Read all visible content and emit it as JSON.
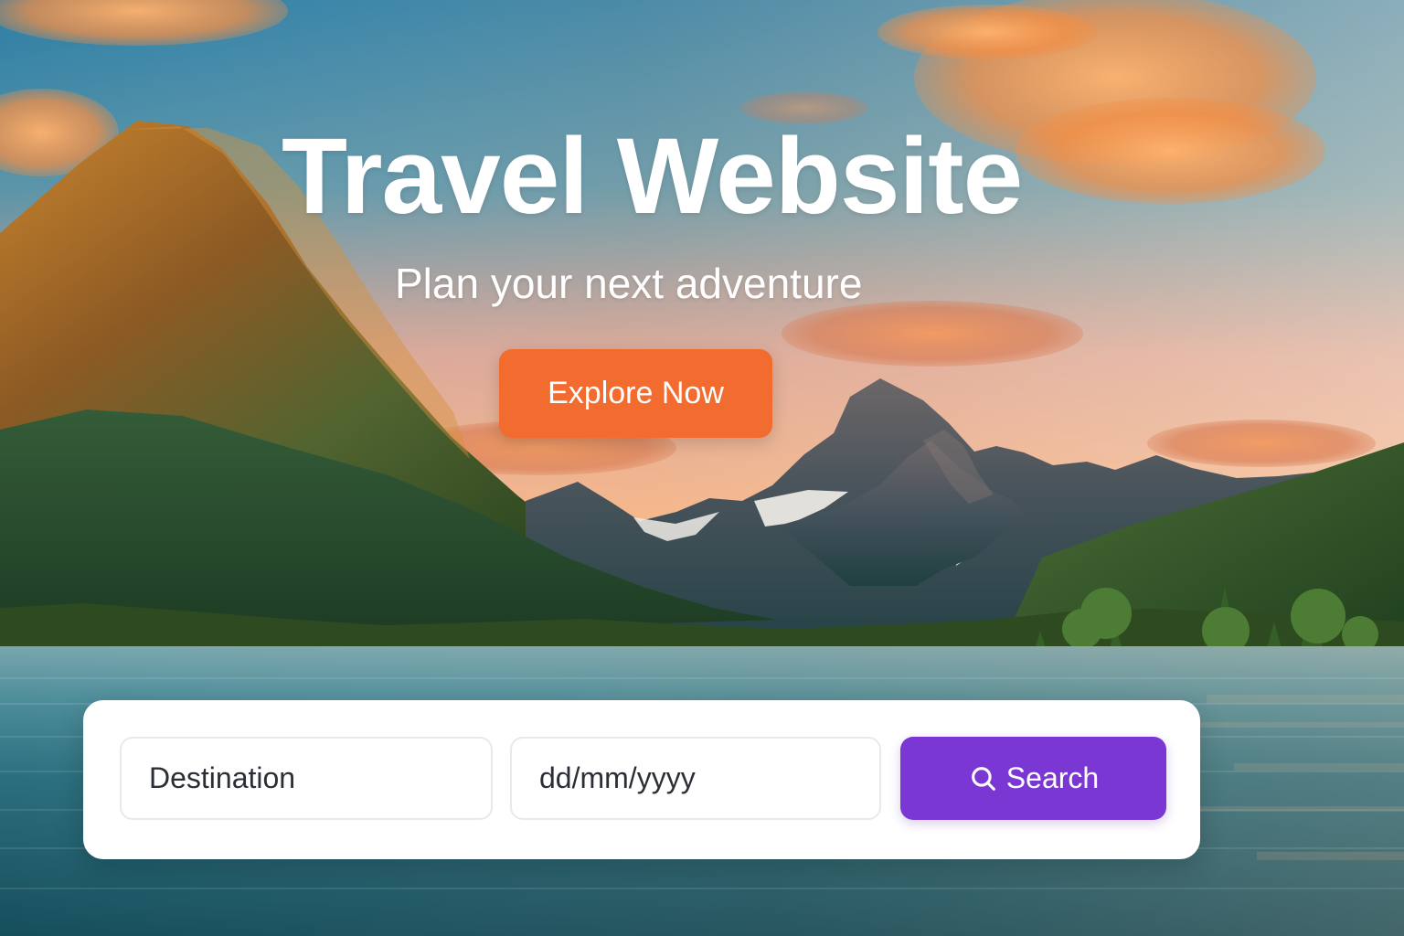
{
  "hero": {
    "title": "Travel Website",
    "subtitle": "Plan your next adventure",
    "cta_label": "Explore Now",
    "background_icon": "mountain-lake-landscape"
  },
  "search": {
    "destination_placeholder": "Destination",
    "date_placeholder": "dd/mm/yyyy",
    "button_label": "Search",
    "button_icon": "search-icon"
  },
  "colors": {
    "cta": "#f26b2f",
    "search_button": "#7a37d3",
    "card": "#ffffff",
    "input_border": "#e7e9ee",
    "text": "#2a2f37"
  }
}
